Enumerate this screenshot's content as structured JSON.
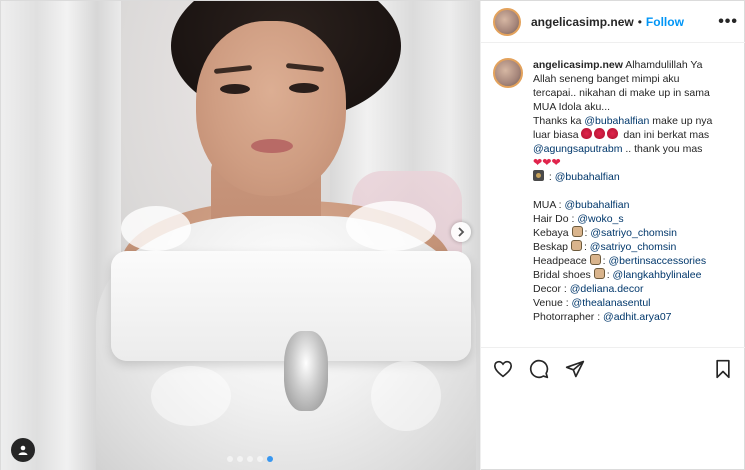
{
  "header": {
    "username": "angelicasimp.new",
    "separator": "•",
    "follow_label": "Follow",
    "more_label": "•••"
  },
  "caption": {
    "username": "angelicasimp.new",
    "line1": "Alhamdulillah Ya",
    "line2": "Allah seneng banget mimpi aku",
    "line3": "tercapai.. nikahan di make up in sama",
    "line4": "MUA Idola aku...",
    "thanks_prefix": "Thanks ka",
    "thanks_mention": "@bubahalfian",
    "thanks_suffix": "make up nya",
    "line6_prefix": "luar biasa",
    "line6_suffix": "dan ini berkat mas",
    "line7_mention": "@agungsaputrabm",
    "line7_suffix": ".. thank you mas",
    "photo_credit_sep": ":",
    "photo_credit_mention": "@bubahalfian",
    "credits": [
      {
        "label": "MUA :",
        "mention": "@bubahalfian",
        "emoji": ""
      },
      {
        "label": "Hair Do :",
        "mention": "@woko_s",
        "emoji": ""
      },
      {
        "label": "Kebaya",
        "mention": "@satriyo_chomsin",
        "emoji": "face"
      },
      {
        "label": "Beskap",
        "mention": "@satriyo_chomsin",
        "emoji": "face"
      },
      {
        "label": "Headpeace",
        "mention": "@bertinsaccessories",
        "emoji": "face"
      },
      {
        "label": "Bridal shoes",
        "mention": "@langkahbylinalee",
        "emoji": "face"
      },
      {
        "label": "Decor :",
        "mention": "@deliana.decor",
        "emoji": ""
      },
      {
        "label": "Venue :",
        "mention": "@thealanasentul",
        "emoji": ""
      },
      {
        "label": "Photorrapher :",
        "mention": "@adhit.arya07",
        "emoji": ""
      }
    ],
    "emoji_colon": ":"
  },
  "icons": {
    "next": "chevron-right-icon",
    "tag": "user-tag-icon",
    "like": "heart-icon",
    "comment": "comment-icon",
    "share": "paper-plane-icon",
    "save": "bookmark-icon"
  },
  "carousel": {
    "count": 5,
    "active_index": 4
  },
  "colors": {
    "follow": "#0095f6",
    "mention": "#00376b",
    "active_dot": "#3897f0"
  }
}
